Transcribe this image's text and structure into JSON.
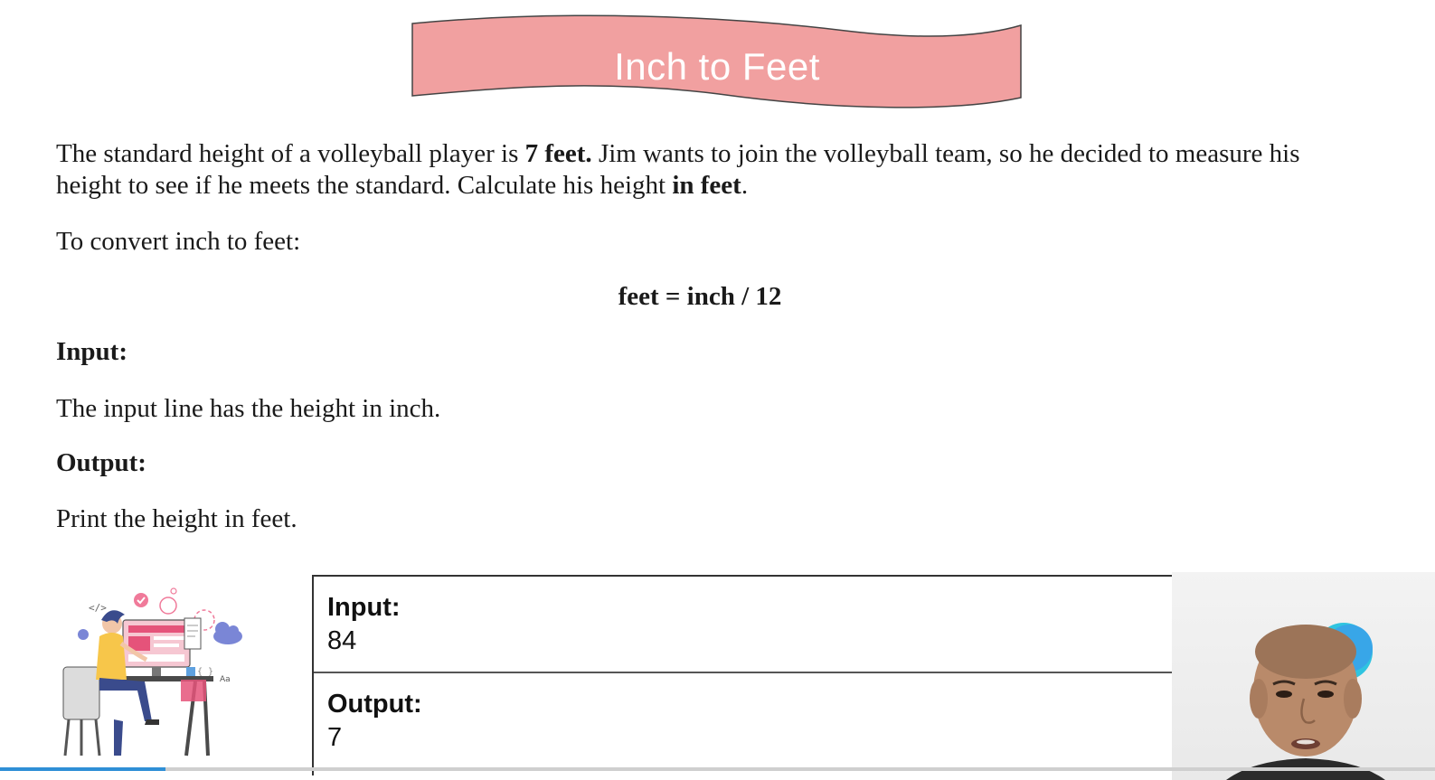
{
  "banner": {
    "title": "Inch to Feet",
    "color": "#f1a0a0"
  },
  "problem": {
    "intro_part1": "The standard height of a volleyball player is ",
    "intro_bold1": "7 feet.",
    "intro_part2": " Jim wants to join the volleyball team, so he decided to measure his height to see if he meets the standard. Calculate his height ",
    "intro_bold2": "in feet",
    "intro_part3": ".",
    "convert_text": "To convert inch to feet:",
    "formula": "feet = inch / 12",
    "input_heading": "Input:",
    "input_description": "The input line has the height in inch.",
    "output_heading": "Output:",
    "output_description": "Print the height in feet."
  },
  "example": {
    "input_label": "Input:",
    "input_value": "84",
    "output_label": "Output:",
    "output_value": "7"
  },
  "video": {
    "progress": 0.115,
    "accent": "#2f8fd6"
  }
}
